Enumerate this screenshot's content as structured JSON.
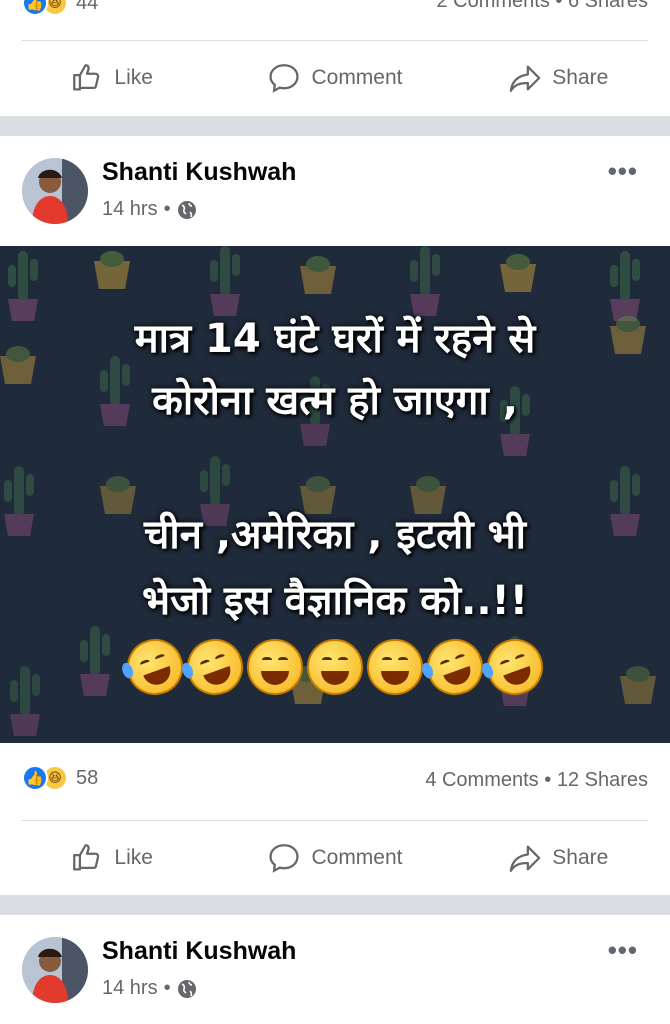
{
  "top_post": {
    "reaction_count": "44",
    "stats_right": "2 Comments • 6 Shares"
  },
  "actions": {
    "like": "Like",
    "comment": "Comment",
    "share": "Share"
  },
  "post": {
    "author": "Shanti Kushwah",
    "time": "14 hrs",
    "separator": "•",
    "more": "•••",
    "caption_line1": "मात्र 14 घंटे घरों में रहने से",
    "caption_line2": "कोरोना खत्म हो जाएगा ,",
    "caption_line3": "चीन ,अमेरिका , इटली भी",
    "caption_line4": "भेजो इस वैज्ञानिक को..!!",
    "reaction_count": "58",
    "comments": "4 Comments",
    "stats_sep": "•",
    "shares": "12 Shares"
  },
  "next_post": {
    "author": "Shanti Kushwah",
    "time": "14 hrs",
    "separator": "•",
    "more": "•••"
  },
  "colors": {
    "like_blue": "#1877f2",
    "text_secondary": "#65676b",
    "image_bg": "#1f2a3a",
    "feed_gap": "#dadde1"
  },
  "icons": [
    "like-reaction-icon",
    "haha-reaction-icon",
    "thumbs-up-icon",
    "comment-icon",
    "share-icon",
    "globe-icon",
    "more-options-icon"
  ]
}
